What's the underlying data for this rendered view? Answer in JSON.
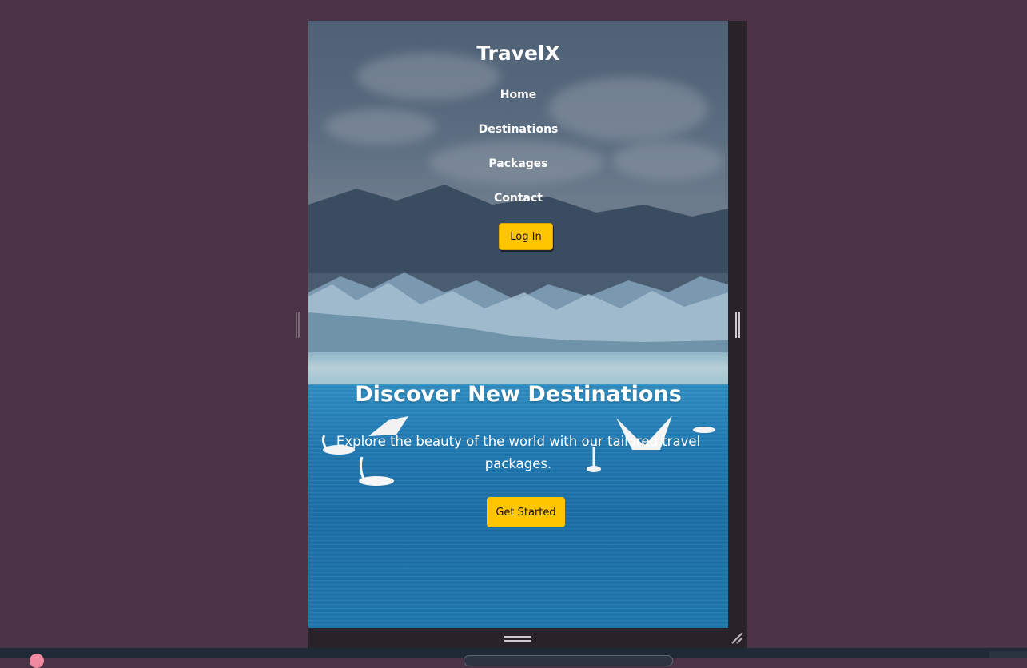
{
  "site": {
    "brand": "TravelX",
    "nav": [
      "Home",
      "Destinations",
      "Packages",
      "Contact"
    ],
    "login_label": "Log In"
  },
  "hero": {
    "title": "Discover New Destinations",
    "subtitle": "Explore the beauty of the world with our tailored travel packages.",
    "cta_label": "Get Started"
  },
  "colors": {
    "accent": "#ffc600",
    "page_background": "#4a3347",
    "text": "#ffffff"
  },
  "icons": [
    "resize-handle-left-icon",
    "resize-handle-right-icon",
    "resize-handle-bottom-icon",
    "resize-corner-icon"
  ]
}
